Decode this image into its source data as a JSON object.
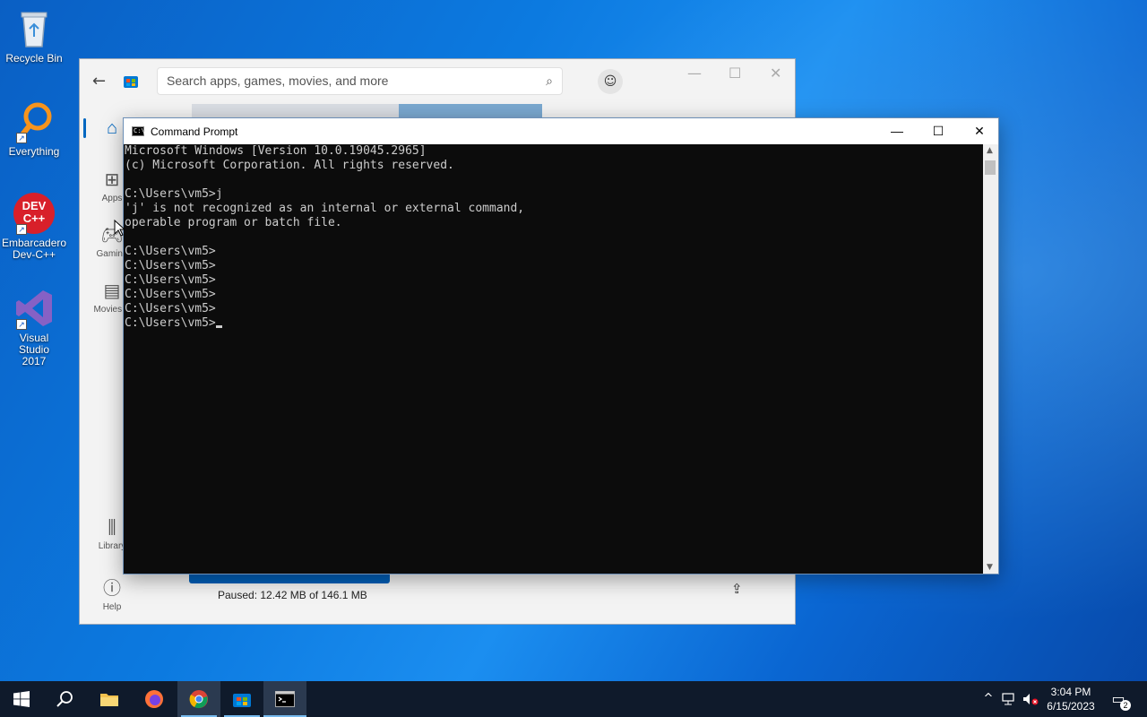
{
  "desktop": {
    "icons": [
      {
        "label": "Recycle Bin",
        "icon": "recycle-bin-icon"
      },
      {
        "label": "Everything",
        "icon": "everything-search-icon"
      },
      {
        "label": "Embarcadero Dev-C++",
        "icon": "devcpp-icon",
        "glyph": "DEV C++"
      },
      {
        "label": "Visual Studio 2017",
        "icon": "visual-studio-icon"
      }
    ]
  },
  "store": {
    "search_placeholder": "Search apps, games, movies, and more",
    "sidebar": [
      {
        "label": "",
        "icon": "home-icon"
      },
      {
        "label": "Apps",
        "icon": "apps-icon"
      },
      {
        "label": "Gaming",
        "icon": "gaming-icon"
      },
      {
        "label": "Movies &",
        "icon": "movies-icon"
      },
      {
        "label": "Library",
        "icon": "library-icon"
      },
      {
        "label": "Help",
        "icon": "help-icon"
      }
    ],
    "download_status": "Paused: 12.42 MB of 146.1 MB"
  },
  "cmd": {
    "title": "Command Prompt",
    "lines": [
      "Microsoft Windows [Version 10.0.19045.2965]",
      "(c) Microsoft Corporation. All rights reserved.",
      "",
      "C:\\Users\\vm5>j",
      "'j' is not recognized as an internal or external command,",
      "operable program or batch file.",
      "",
      "C:\\Users\\vm5>",
      "C:\\Users\\vm5>",
      "C:\\Users\\vm5>",
      "C:\\Users\\vm5>",
      "C:\\Users\\vm5>",
      "C:\\Users\\vm5>"
    ],
    "minimize": "—",
    "maximize": "☐",
    "close": "✕"
  },
  "taskbar": {
    "apps": [
      {
        "name": "start-button",
        "glyph": "⊞"
      },
      {
        "name": "search-button",
        "glyph": "⌕"
      },
      {
        "name": "file-explorer",
        "glyph": "▬"
      },
      {
        "name": "firefox",
        "glyph": "●"
      },
      {
        "name": "chrome",
        "glyph": "◉"
      },
      {
        "name": "microsoft-store",
        "glyph": "▣"
      },
      {
        "name": "command-prompt",
        "glyph": ">_"
      }
    ],
    "time": "3:04 PM",
    "date": "6/15/2023",
    "notification_count": "2"
  },
  "colors": {
    "cmd_bg": "#0c0c0c",
    "cmd_text": "#cccccc",
    "taskbar": "#0f1a2b",
    "accent": "#0067c0"
  }
}
